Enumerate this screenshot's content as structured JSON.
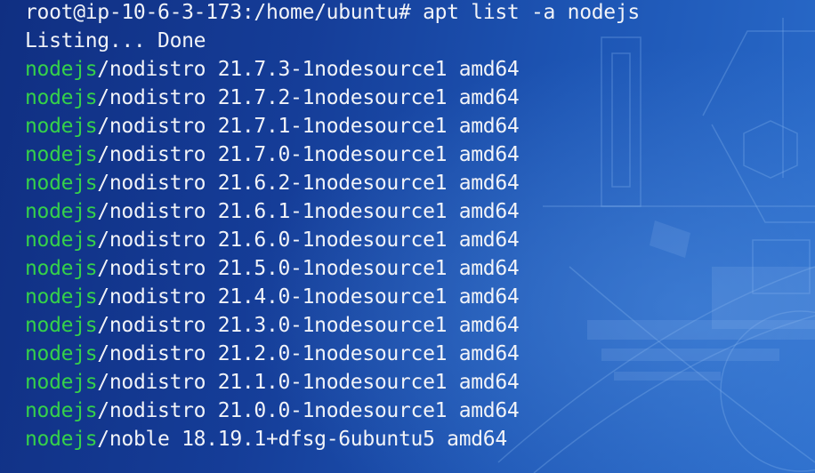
{
  "terminal": {
    "prompt": "root@ip-10-6-3-173:/home/ubuntu#",
    "command": "apt list -a nodejs",
    "status": "Listing... Done",
    "packages": [
      {
        "name": "nodejs",
        "rest": "/nodistro 21.7.3-1nodesource1 amd64"
      },
      {
        "name": "nodejs",
        "rest": "/nodistro 21.7.2-1nodesource1 amd64"
      },
      {
        "name": "nodejs",
        "rest": "/nodistro 21.7.1-1nodesource1 amd64"
      },
      {
        "name": "nodejs",
        "rest": "/nodistro 21.7.0-1nodesource1 amd64"
      },
      {
        "name": "nodejs",
        "rest": "/nodistro 21.6.2-1nodesource1 amd64"
      },
      {
        "name": "nodejs",
        "rest": "/nodistro 21.6.1-1nodesource1 amd64"
      },
      {
        "name": "nodejs",
        "rest": "/nodistro 21.6.0-1nodesource1 amd64"
      },
      {
        "name": "nodejs",
        "rest": "/nodistro 21.5.0-1nodesource1 amd64"
      },
      {
        "name": "nodejs",
        "rest": "/nodistro 21.4.0-1nodesource1 amd64"
      },
      {
        "name": "nodejs",
        "rest": "/nodistro 21.3.0-1nodesource1 amd64"
      },
      {
        "name": "nodejs",
        "rest": "/nodistro 21.2.0-1nodesource1 amd64"
      },
      {
        "name": "nodejs",
        "rest": "/nodistro 21.1.0-1nodesource1 amd64"
      },
      {
        "name": "nodejs",
        "rest": "/nodistro 21.0.0-1nodesource1 amd64"
      },
      {
        "name": "nodejs",
        "rest": "/noble 18.19.1+dfsg-6ubuntu5 amd64"
      }
    ]
  },
  "colors": {
    "background": "#153d98",
    "text": "#f1f3f8",
    "package_name": "#35d14a"
  }
}
